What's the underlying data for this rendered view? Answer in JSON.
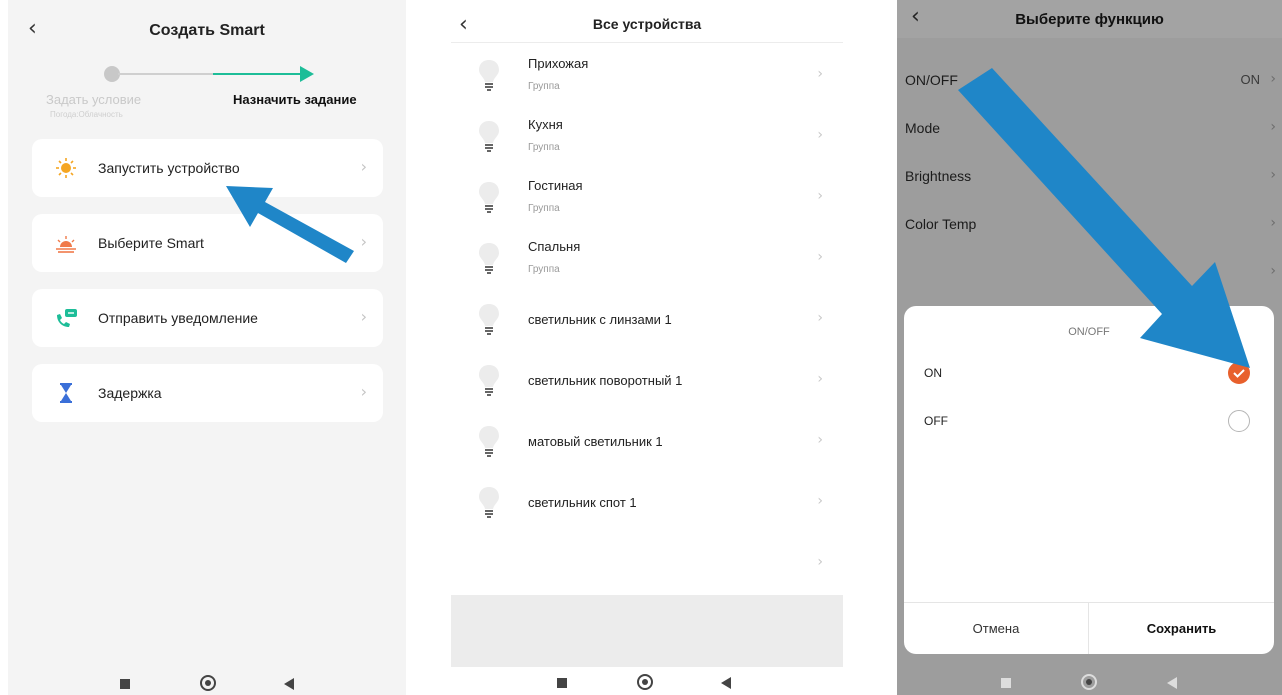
{
  "colors": {
    "accent_green": "#1dbd98",
    "arrow_blue": "#1f86c8",
    "check_orange": "#e8602c",
    "overlay_gray": "#9d9d9d"
  },
  "panel1": {
    "back_icon": "chevron-left-icon",
    "title": "Создать Smart",
    "steps": {
      "condition_label": "Задать условие",
      "condition_sub": "Погода:Облачность",
      "task_label": "Назначить задание"
    },
    "items": [
      {
        "label": "Запустить устройство",
        "icon": "sun-icon"
      },
      {
        "label": "Выберите Smart",
        "icon": "sunrise-icon"
      },
      {
        "label": "Отправить уведомление",
        "icon": "phone-message-icon"
      },
      {
        "label": "Задержка",
        "icon": "hourglass-icon"
      }
    ]
  },
  "panel2": {
    "back_icon": "chevron-left-icon",
    "title": "Все устройства",
    "devices": [
      {
        "name": "Прихожая",
        "sub": "Группа"
      },
      {
        "name": "Кухня",
        "sub": "Группа"
      },
      {
        "name": "Гостиная",
        "sub": "Группа"
      },
      {
        "name": "Спальня",
        "sub": "Группа"
      },
      {
        "name": "светильник с линзами 1"
      },
      {
        "name": "светильник поворотный 1"
      },
      {
        "name": "матовый светильник 1"
      },
      {
        "name": "светильник спот 1"
      }
    ]
  },
  "panel3": {
    "back_icon": "chevron-left-icon",
    "title": "Выберите функцию",
    "functions": [
      {
        "name": "ON/OFF",
        "value": "ON"
      },
      {
        "name": "Mode"
      },
      {
        "name": "Brightness"
      },
      {
        "name": "Color Temp"
      },
      {
        "name": ""
      }
    ],
    "sheet": {
      "title": "ON/OFF",
      "options": [
        {
          "label": "ON",
          "selected": true
        },
        {
          "label": "OFF",
          "selected": false
        }
      ],
      "cancel": "Отмена",
      "save": "Сохранить"
    }
  }
}
